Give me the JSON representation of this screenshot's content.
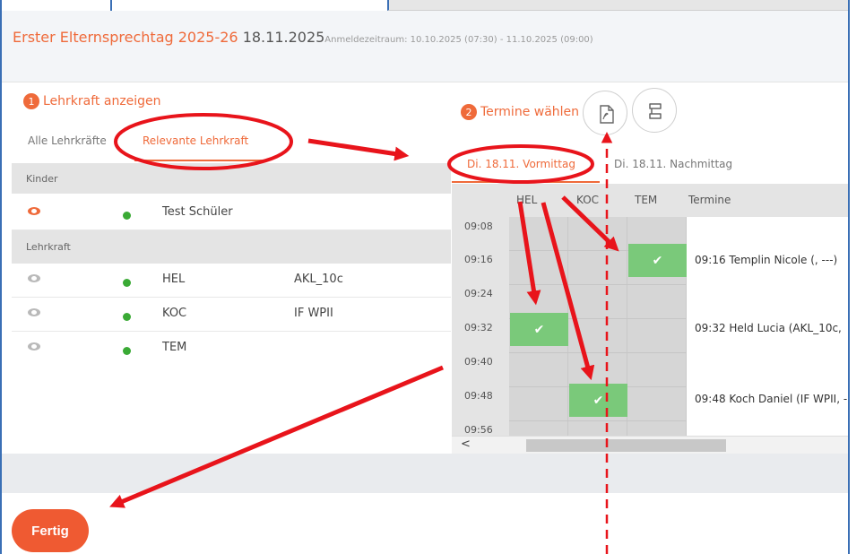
{
  "header": {
    "title": "Erster Elternsprechtag 2025-26",
    "date": "18.11.2025",
    "registration_period": "Anmeldezeitraum: 10.10.2025 (07:30) - 11.10.2025 (09:00)"
  },
  "step1": {
    "number": "1",
    "label": "Lehrkraft anzeigen",
    "tabs": [
      "Alle Lehrkräfte",
      "Relevante Lehrkraft"
    ],
    "active_tab": "Relevante Lehrkraft"
  },
  "sections": {
    "children": "Kinder",
    "teachers": "Lehrkraft"
  },
  "children": [
    {
      "name": "Test Schüler",
      "visible": true
    }
  ],
  "teachers": [
    {
      "code": "HEL",
      "course": "AKL_10c"
    },
    {
      "code": "KOC",
      "course": "IF WPII"
    },
    {
      "code": "TEM",
      "course": ""
    }
  ],
  "step2": {
    "number": "2",
    "label": "Termine wählen",
    "tabs": [
      "Di. 18.11. Vormittag",
      "Di. 18.11. Nachmittag"
    ],
    "active_tab": "Di. 18.11. Vormittag"
  },
  "toolbar": {
    "pdf_icon": "pdf-icon",
    "print_icon": "list-icon"
  },
  "schedule": {
    "columns": [
      "HEL",
      "KOC",
      "TEM",
      "Termine"
    ],
    "times": [
      "09:08",
      "09:16",
      "09:24",
      "09:32",
      "09:40",
      "09:48",
      "09:56"
    ],
    "entries": [
      {
        "time": "09:16",
        "teacher": "TEM",
        "text": "09:16 Templin Nicole (, ---)"
      },
      {
        "time": "09:32",
        "teacher": "HEL",
        "text": "09:32 Held Lucia (AKL_10c,"
      },
      {
        "time": "09:48",
        "teacher": "KOC",
        "text": "09:48 Koch Daniel (IF WPII, -"
      }
    ],
    "check_glyph": "✔",
    "scroll_left": "<"
  },
  "footer": {
    "done_label": "Fertig"
  },
  "colors": {
    "accent": "#ef6a3a",
    "done_button": "#ef5a32",
    "booked": "#7ac97a",
    "status_dot": "#3aaa35",
    "annotation": "#e8141b",
    "frame": "#3a6fb5"
  }
}
